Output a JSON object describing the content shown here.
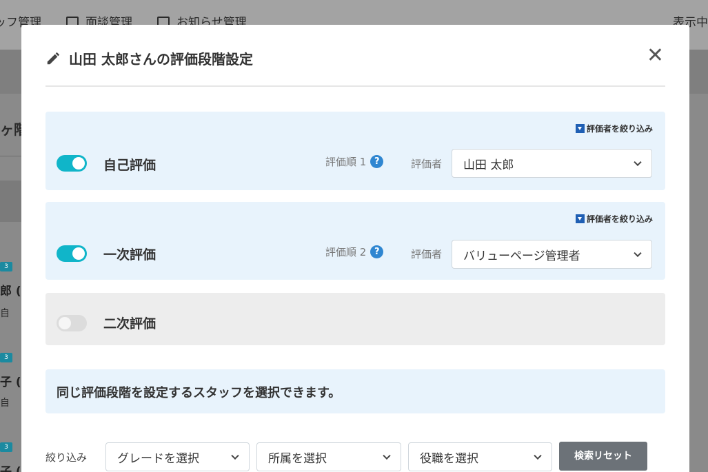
{
  "background": {
    "nav": [
      {
        "label": "ッフ管理",
        "icon": ""
      },
      {
        "label": "面談管理",
        "icon": "monitor-icon"
      },
      {
        "label": "お知らせ管理",
        "icon": "book-icon"
      }
    ],
    "right_text": "表示中",
    "page_title": "ヶ階訁",
    "rows": [
      {
        "badge": "3",
        "name": "郎 (",
        "sub": "自"
      },
      {
        "badge": "3",
        "name": "子 (",
        "sub": "自"
      },
      {
        "badge": "3",
        "name": "子 (",
        "sub": ""
      }
    ]
  },
  "modal": {
    "title": "山田 太郎さんの評価段階設定",
    "title_icon": "pencil-icon",
    "close_icon": "close-icon",
    "close_glyph": "✕",
    "stages": [
      {
        "label": "自己評価",
        "enabled": true,
        "order_label": "評価順 1",
        "help_glyph": "?",
        "evaluator_label": "評価者",
        "evaluator_value": "山田 太郎",
        "filter_link": "評価者を絞り込み"
      },
      {
        "label": "一次評価",
        "enabled": true,
        "order_label": "評価順 2",
        "help_glyph": "?",
        "evaluator_label": "評価者",
        "evaluator_value": "バリューページ管理者",
        "filter_link": "評価者を絞り込み"
      },
      {
        "label": "二次評価",
        "enabled": false
      }
    ],
    "notice": "同じ評価段階を設定するスタッフを選択できます。",
    "filter": {
      "label": "絞り込み",
      "grade_placeholder": "グレードを選択",
      "dept_placeholder": "所属を選択",
      "position_placeholder": "役職を選択",
      "reset_label": "検索リセット"
    }
  },
  "colors": {
    "accent": "#10b5c9",
    "panel": "#e8f3fc",
    "link": "#1f5fb4",
    "button": "#6c7278"
  }
}
